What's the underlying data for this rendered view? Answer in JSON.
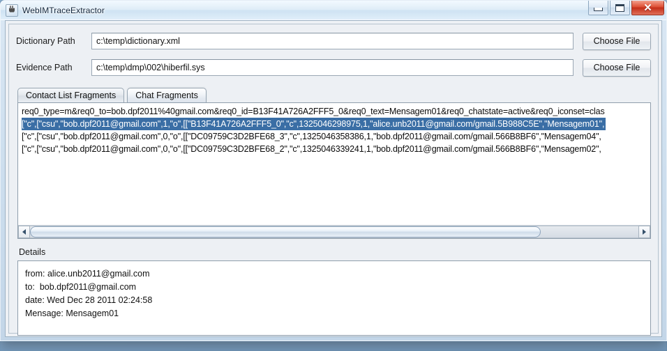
{
  "window": {
    "title": "WebIMTraceExtractor",
    "icon": "java-app-icon",
    "controls": {
      "minimize": "minimize-button",
      "maximize": "maximize-button",
      "close": "✕"
    }
  },
  "form": {
    "dictionary": {
      "label": "Dictionary Path",
      "value": "c:\\temp\\dictionary.xml",
      "placeholder": "",
      "button": "Choose File"
    },
    "evidence": {
      "label": "Evidence Path",
      "value": "c:\\temp\\dmp\\002\\hiberfil.sys",
      "placeholder": "",
      "button": "Choose File"
    }
  },
  "tabs": [
    {
      "label": "Contact List Fragments",
      "selected": false
    },
    {
      "label": "Chat Fragments",
      "selected": true
    }
  ],
  "fragments": {
    "lines": [
      {
        "text": "req0_type=m&req0_to=bob.dpf2011%40gmail.com&req0_id=B13F41A726A2FFF5_0&req0_text=Mensagem01&req0_chatstate=active&req0_iconset=clas",
        "selected": false
      },
      {
        "text": "[\"c\",[\"csu\",\"bob.dpf2011@gmail.com\",1,\"o\",[[\"B13F41A726A2FFF5_0\",\"c\",1325046298975,1,\"alice.unb2011@gmail.com/gmail.5B988C5E\",\"Mensagem01\",",
        "selected": true
      },
      {
        "text": "[\"c\",[\"csu\",\"bob.dpf2011@gmail.com\",0,\"o\",[[\"DC09759C3D2BFE68_3\",\"c\",1325046358386,1,\"bob.dpf2011@gmail.com/gmail.566B8BF6\",\"Mensagem04\",",
        "selected": false
      },
      {
        "text": "[\"c\",[\"csu\",\"bob.dpf2011@gmail.com\",0,\"o\",[[\"DC09759C3D2BFE68_2\",\"c\",1325046339241,1,\"bob.dpf2011@gmail.com/gmail.566B8BF6\",\"Mensagem02\",",
        "selected": false
      }
    ],
    "scrollbar": {
      "left_arrow": "scroll-left-arrow",
      "right_arrow": "scroll-right-arrow",
      "thumb_ratio": "84%"
    }
  },
  "details": {
    "label": "Details",
    "lines": [
      "from: alice.unb2011@gmail.com",
      "to:  bob.dpf2011@gmail.com",
      "date: Wed Dec 28 2011 02:24:58",
      "Mensage: Mensagem01"
    ]
  },
  "colors": {
    "selection": "#3a6ea5",
    "close_button": "#c4301a",
    "panel": "#edf0f4"
  }
}
